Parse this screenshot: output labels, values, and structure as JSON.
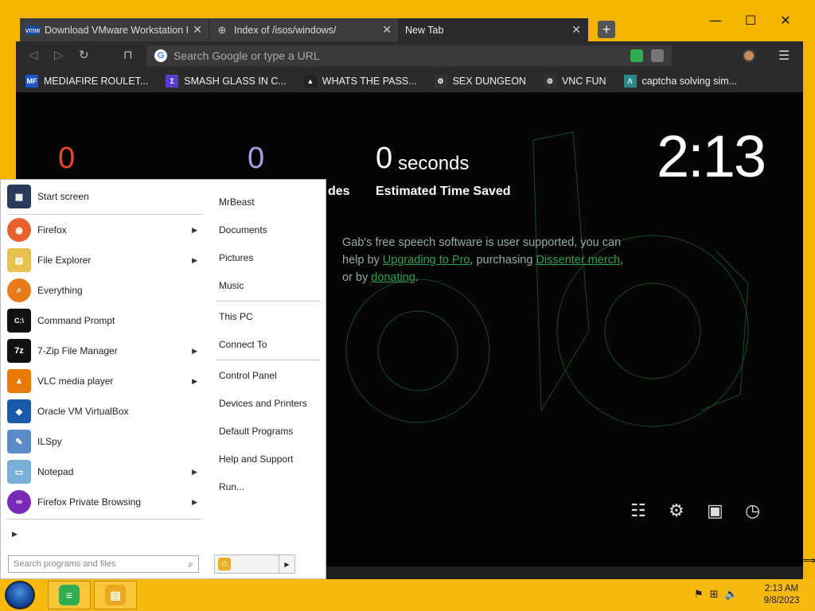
{
  "browser": {
    "tabs": [
      {
        "title": "Download VMware Workstation Pl",
        "favicon": "vmw"
      },
      {
        "title": "Index of /isos/windows/",
        "favicon": "globe"
      },
      {
        "title": "New Tab",
        "favicon": ""
      }
    ],
    "new_tab": "+",
    "window_controls": {
      "minimize": "—",
      "maximize": "☐",
      "close": "✕"
    },
    "omnibox_placeholder": "Search Google or type a URL",
    "bookmarks": [
      {
        "label": "MEDIAFIRE ROULET...",
        "icon": "MF",
        "color": "#1a56c8"
      },
      {
        "label": "SMASH GLASS IN C...",
        "icon": "Σ",
        "color": "#5a3bd1"
      },
      {
        "label": "WHATS THE PASS...",
        "icon": "▲",
        "color": "#222222"
      },
      {
        "label": "SEX DUNGEON",
        "icon": "⚙",
        "color": "#333333"
      },
      {
        "label": "VNC FUN",
        "icon": "⚙",
        "color": "#333333"
      },
      {
        "label": "captcha solving sim...",
        "icon": "Λ",
        "color": "#2a8a8a"
      }
    ]
  },
  "newtab": {
    "stats": [
      {
        "value": "0",
        "color": "#e8452c"
      },
      {
        "value": "0",
        "color": "#a8a0e8"
      },
      {
        "value": "0",
        "unit": "seconds",
        "color": "#ffffff",
        "label": "Estimated Time Saved"
      }
    ],
    "partial_label": "des",
    "clock": "2:13",
    "text": {
      "p1": "Gab's free speech software is user supported, you can help by ",
      "link1": "Upgrading to Pro",
      "p2": ", purchasing ",
      "link2": "Dissenter merch",
      "p3": ", or by ",
      "link3": "donating",
      "p4": "."
    }
  },
  "startmenu": {
    "programs": [
      {
        "label": "Start screen",
        "icon": "▦",
        "color": "#2a3a5a",
        "arrow": false
      },
      {
        "label": "Firefox",
        "icon": "◉",
        "color": "#e8602c",
        "arrow": true
      },
      {
        "label": "File Explorer",
        "icon": "▤",
        "color": "#e8c050",
        "arrow": true
      },
      {
        "label": "Everything",
        "icon": "⌕",
        "color": "#e87a1a",
        "arrow": false
      },
      {
        "label": "Command Prompt",
        "icon": "C:\\",
        "color": "#111111",
        "arrow": false
      },
      {
        "label": "7-Zip File Manager",
        "icon": "7z",
        "color": "#111111",
        "arrow": true
      },
      {
        "label": "VLC media player",
        "icon": "▲",
        "color": "#e87a00",
        "arrow": true
      },
      {
        "label": "Oracle VM VirtualBox",
        "icon": "◆",
        "color": "#1a5aa8",
        "arrow": false
      },
      {
        "label": "ILSpy",
        "icon": "✎",
        "color": "#5a8ac8",
        "arrow": false
      },
      {
        "label": "Notepad",
        "icon": "▭",
        "color": "#7ab0d8",
        "arrow": true
      },
      {
        "label": "Firefox Private Browsing",
        "icon": "∞",
        "color": "#7a2ab8",
        "arrow": true
      }
    ],
    "search_placeholder": "Search programs and files",
    "all_programs_arrow": "▶",
    "places": [
      "MrBeast",
      "Documents",
      "Pictures",
      "Music",
      "This PC",
      "Connect To",
      "Control Panel",
      "Devices and Printers",
      "Default Programs",
      "Help and Support",
      "Run..."
    ]
  },
  "taskbar": {
    "tray_icons": [
      "flag-icon",
      "network-icon",
      "volume-icon"
    ],
    "time": "2:13 AM",
    "date": "9/8/2023"
  }
}
